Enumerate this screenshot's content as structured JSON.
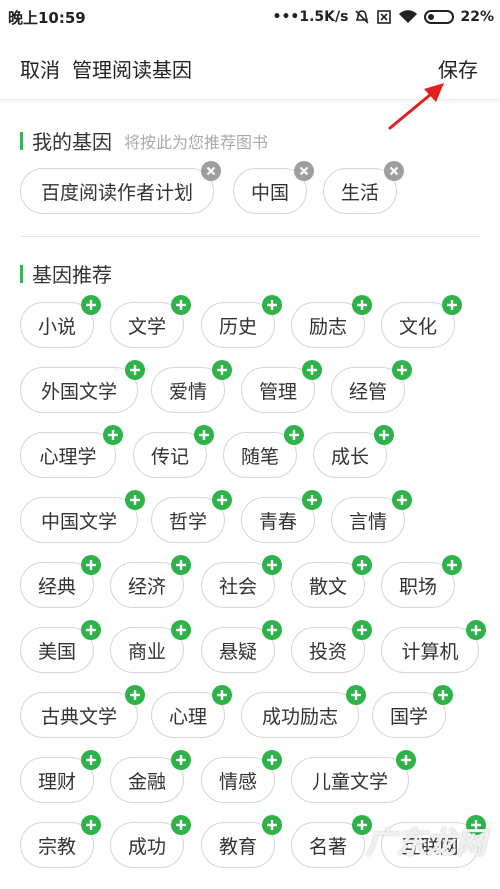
{
  "status": {
    "time": "晚上10:59",
    "network": "•••1.5K/s",
    "battery": "22%"
  },
  "header": {
    "cancel": "取消",
    "title": "管理阅读基因",
    "save": "保存"
  },
  "my_genes": {
    "title": "我的基因",
    "subtitle": "将按此为您推荐图书",
    "tags": [
      "百度阅读作者计划",
      "中国",
      "生活"
    ]
  },
  "recommended": {
    "title": "基因推荐",
    "tags": [
      "小说",
      "文学",
      "历史",
      "励志",
      "文化",
      "外国文学",
      "爱情",
      "管理",
      "经管",
      "心理学",
      "传记",
      "随笔",
      "成长",
      "中国文学",
      "哲学",
      "青春",
      "言情",
      "经典",
      "经济",
      "社会",
      "散文",
      "职场",
      "美国",
      "商业",
      "悬疑",
      "投资",
      "计算机",
      "古典文学",
      "心理",
      "成功励志",
      "国学",
      "理财",
      "金融",
      "情感",
      "儿童文学",
      "宗教",
      "成功",
      "教育",
      "名著",
      "互联网"
    ]
  },
  "watermark": "广东龙网",
  "colors": {
    "accent": "#2fb24a",
    "remove": "#9e9e9e",
    "arrow": "#e02020"
  }
}
